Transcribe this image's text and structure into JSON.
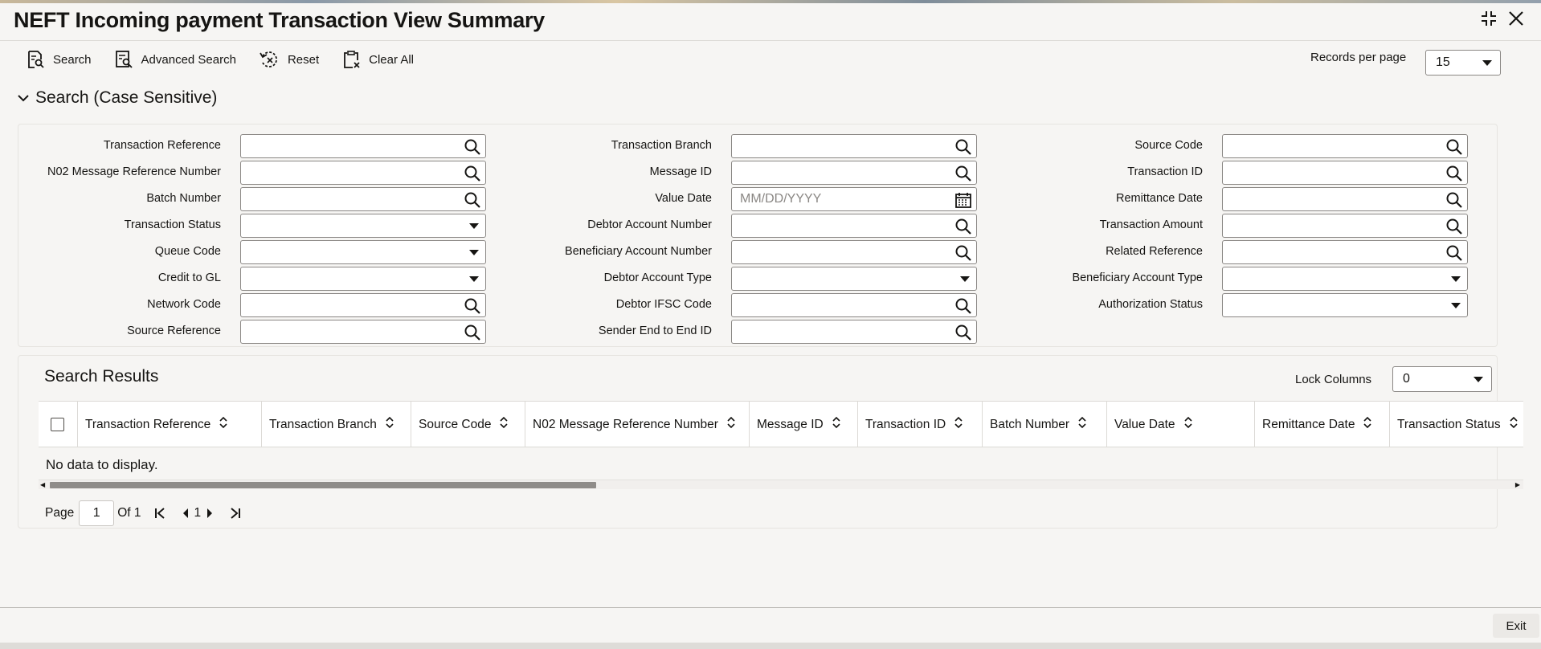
{
  "window": {
    "title": "NEFT Incoming payment Transaction View Summary"
  },
  "toolbar": {
    "search_label": "Search",
    "advanced_search_label": "Advanced Search",
    "reset_label": "Reset",
    "clear_all_label": "Clear All"
  },
  "records_per_page": {
    "label": "Records per page",
    "value": "15"
  },
  "search_section": {
    "title": "Search (Case Sensitive)",
    "fields": [
      {
        "label": "Transaction Reference",
        "type": "lookup",
        "value": ""
      },
      {
        "label": "N02 Message Reference Number",
        "type": "lookup",
        "value": ""
      },
      {
        "label": "Batch Number",
        "type": "lookup",
        "value": ""
      },
      {
        "label": "Transaction Status",
        "type": "select",
        "value": ""
      },
      {
        "label": "Queue Code",
        "type": "select",
        "value": ""
      },
      {
        "label": "Credit to GL",
        "type": "select",
        "value": ""
      },
      {
        "label": "Network Code",
        "type": "lookup",
        "value": ""
      },
      {
        "label": "Source Reference",
        "type": "lookup",
        "value": ""
      },
      {
        "label": "Transaction Branch",
        "type": "lookup",
        "value": ""
      },
      {
        "label": "Message ID",
        "type": "lookup",
        "value": ""
      },
      {
        "label": "Value Date",
        "type": "date",
        "value": "",
        "placeholder": "MM/DD/YYYY"
      },
      {
        "label": "Debtor Account Number",
        "type": "lookup",
        "value": ""
      },
      {
        "label": "Beneficiary Account Number",
        "type": "lookup",
        "value": ""
      },
      {
        "label": "Debtor Account Type",
        "type": "select",
        "value": ""
      },
      {
        "label": "Debtor IFSC Code",
        "type": "lookup",
        "value": ""
      },
      {
        "label": "Sender End to End ID",
        "type": "lookup",
        "value": ""
      },
      {
        "label": "Source Code",
        "type": "lookup",
        "value": ""
      },
      {
        "label": "Transaction ID",
        "type": "lookup",
        "value": ""
      },
      {
        "label": "Remittance Date",
        "type": "lookup",
        "value": ""
      },
      {
        "label": "Transaction Amount",
        "type": "lookup",
        "value": ""
      },
      {
        "label": "Related Reference",
        "type": "lookup",
        "value": ""
      },
      {
        "label": "Beneficiary Account Type",
        "type": "select",
        "value": ""
      },
      {
        "label": "Authorization Status",
        "type": "select",
        "value": ""
      }
    ]
  },
  "results": {
    "title": "Search Results",
    "lock_columns_label": "Lock Columns",
    "lock_columns_value": "0",
    "columns": [
      "Transaction Reference",
      "Transaction Branch",
      "Source Code",
      "N02 Message Reference Number",
      "Message ID",
      "Transaction ID",
      "Batch Number",
      "Value Date",
      "Remittance Date",
      "Transaction Status"
    ],
    "empty_message": "No data to display."
  },
  "pagination": {
    "page_label": "Page",
    "current_page": "1",
    "of_label": "Of 1",
    "page_number": "1"
  },
  "footer": {
    "exit_label": "Exit"
  },
  "icons": {
    "lookup": "magnifier-icon",
    "date": "calendar-icon",
    "select": "caret-down-icon",
    "sort": "sort-icon"
  }
}
